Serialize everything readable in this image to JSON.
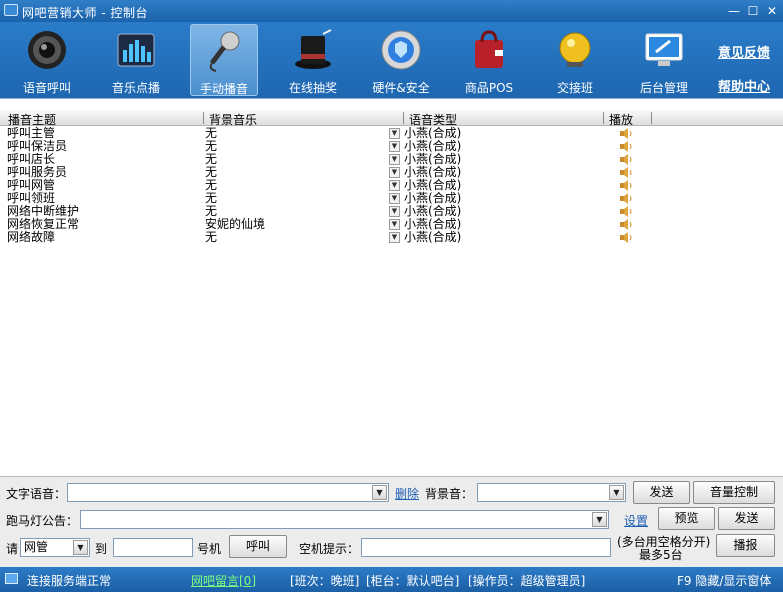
{
  "window": {
    "title": "网吧营销大师 - 控制台",
    "min": "—",
    "max": "☐",
    "close": "✕"
  },
  "toolbar": {
    "items": [
      {
        "label": "语音呼叫",
        "icon": "speaker-icon"
      },
      {
        "label": "音乐点播",
        "icon": "music-icon"
      },
      {
        "label": "手动播音",
        "icon": "microphone-icon"
      },
      {
        "label": "在线抽奖",
        "icon": "magic-hat-icon"
      },
      {
        "label": "硬件&安全",
        "icon": "shield-icon"
      },
      {
        "label": "商品POS",
        "icon": "shopping-bag-icon"
      },
      {
        "label": "交接班",
        "icon": "bell-icon"
      },
      {
        "label": "后台管理",
        "icon": "monitor-icon"
      }
    ],
    "feedback": "意见反馈",
    "help": "帮助中心"
  },
  "table": {
    "headers": [
      "播音主题",
      "背景音乐",
      "语音类型",
      "播放"
    ],
    "rows": [
      {
        "topic": "呼叫主管",
        "music": "无",
        "voice": "小燕(合成)"
      },
      {
        "topic": "呼叫保洁员",
        "music": "无",
        "voice": "小燕(合成)"
      },
      {
        "topic": "呼叫店长",
        "music": "无",
        "voice": "小燕(合成)"
      },
      {
        "topic": "呼叫服务员",
        "music": "无",
        "voice": "小燕(合成)"
      },
      {
        "topic": "呼叫网管",
        "music": "无",
        "voice": "小燕(合成)"
      },
      {
        "topic": "呼叫领班",
        "music": "无",
        "voice": "小燕(合成)"
      },
      {
        "topic": "网络中断维护",
        "music": "无",
        "voice": "小燕(合成)"
      },
      {
        "topic": "网络恢复正常",
        "music": "安妮的仙境",
        "voice": "小燕(合成)"
      },
      {
        "topic": "网络故障",
        "music": "无",
        "voice": "小燕(合成)"
      }
    ]
  },
  "panel": {
    "text_voice_label": "文字语音：",
    "text_voice_value": "",
    "delete": "删除",
    "bg_music_label": "背景音：",
    "bg_music_value": "",
    "send": "发送",
    "volume": "音量控制",
    "marquee_label": "跑马灯公告：",
    "marquee_value": "",
    "settings": "设置",
    "preview": "预览",
    "send2": "发送",
    "please": "请",
    "role_value": "网管",
    "to": "到",
    "machine_from": "",
    "machine_unit": "号机",
    "call": "呼叫",
    "idle_label": "空机提示：",
    "idle_value": "",
    "hint_line1": "(多台用空格分开)",
    "hint_line2": "最多5台",
    "report": "播报"
  },
  "status": {
    "connection": "连接服务端正常",
    "message": "网吧留言[0]",
    "shift": "[班次：晚班]",
    "counter": "[柜台：默认吧台]",
    "operator": "[操作员：超级管理员]",
    "toggle": "F9 隐藏/显示窗体"
  }
}
